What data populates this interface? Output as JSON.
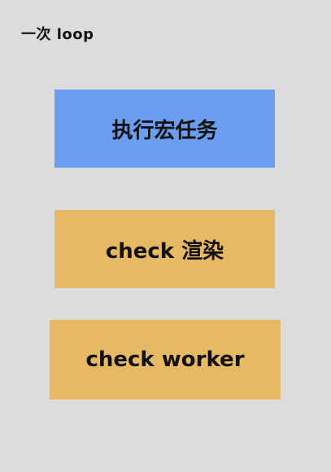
{
  "title": "一次 loop",
  "steps": [
    {
      "label": "执行宏任务",
      "color": "#6b9ef0"
    },
    {
      "label": "check 渲染",
      "color": "#e8b965"
    },
    {
      "label": "check worker",
      "color": "#e8b965"
    }
  ]
}
